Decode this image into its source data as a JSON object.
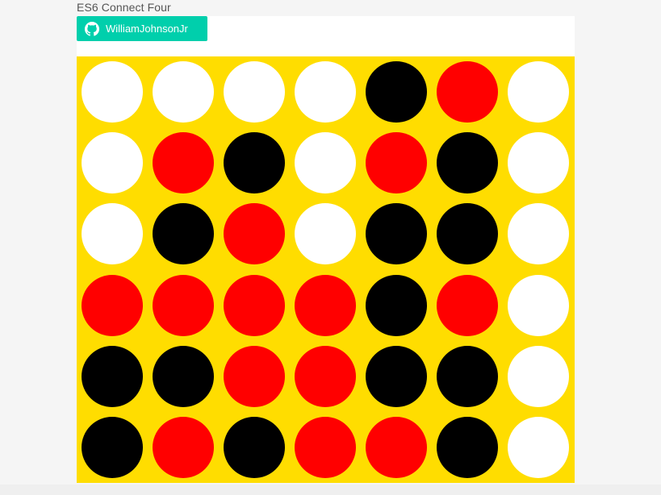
{
  "app": {
    "title": "ES6 Connect Four"
  },
  "github": {
    "label": "WilliamJohnsonJr",
    "icon": "github-icon",
    "color": "#00cfac"
  },
  "colors": {
    "board": "#ffdd00",
    "empty": "#ffffff",
    "red": "#ff0000",
    "black": "#000000"
  },
  "board": {
    "rows": [
      [
        "empty",
        "empty",
        "empty",
        "empty",
        "black",
        "red",
        "empty"
      ],
      [
        "empty",
        "red",
        "black",
        "empty",
        "red",
        "black",
        "empty"
      ],
      [
        "empty",
        "black",
        "red",
        "empty",
        "black",
        "black",
        "empty"
      ],
      [
        "red",
        "red",
        "red",
        "red",
        "black",
        "red",
        "empty"
      ],
      [
        "black",
        "black",
        "red",
        "red",
        "black",
        "black",
        "empty"
      ],
      [
        "black",
        "red",
        "black",
        "red",
        "red",
        "black",
        "empty"
      ]
    ]
  }
}
